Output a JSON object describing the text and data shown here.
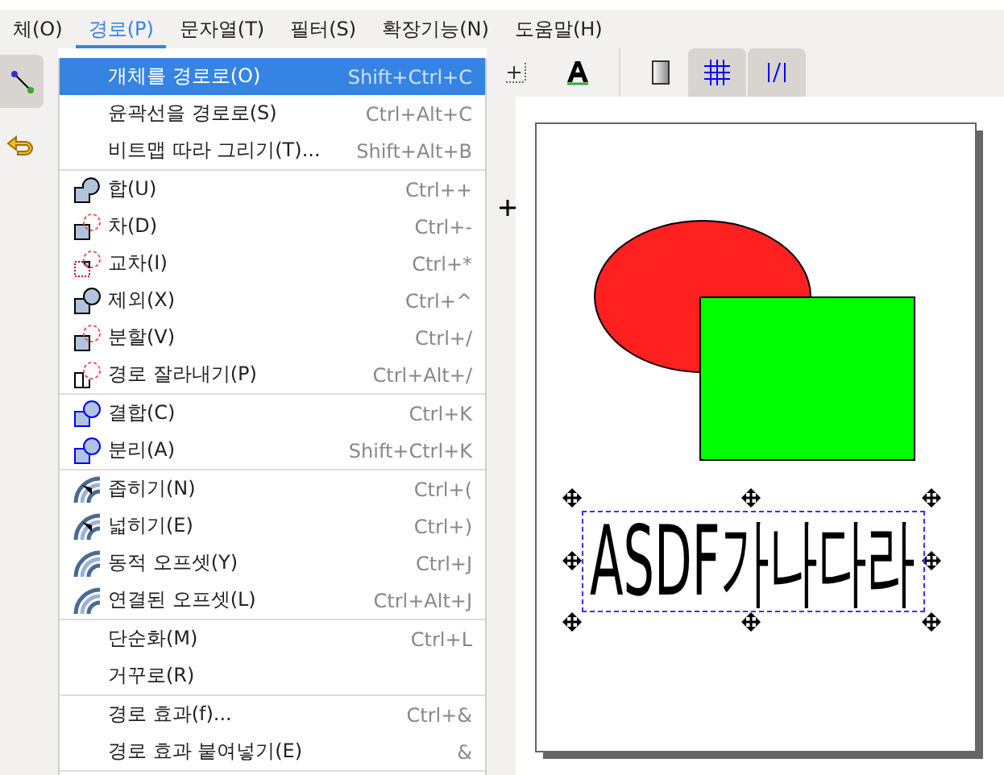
{
  "menubar": [
    {
      "label": "체(O)",
      "selected": false
    },
    {
      "label": "경로(P)",
      "selected": true
    },
    {
      "label": "문자열(T)",
      "selected": false
    },
    {
      "label": "필터(S)",
      "selected": false
    },
    {
      "label": "확장기능(N)",
      "selected": false
    },
    {
      "label": "도움말(H)",
      "selected": false
    }
  ],
  "menu": {
    "sections": [
      [
        {
          "kind": "plain",
          "label": "개체를 경로로(O)",
          "shortcut": "Shift+Ctrl+C",
          "selected": true
        },
        {
          "kind": "plain",
          "label": "윤곽선을 경로로(S)",
          "shortcut": "Ctrl+Alt+C",
          "selected": false
        },
        {
          "kind": "plain",
          "label": "비트맵 따라 그리기(T)...",
          "shortcut": "Shift+Alt+B",
          "selected": false
        }
      ],
      [
        {
          "kind": "boolean",
          "label": "합(U)",
          "shortcut": "Ctrl++",
          "selected": false
        },
        {
          "kind": "boolean",
          "label": "차(D)",
          "shortcut": "Ctrl+-",
          "selected": false
        },
        {
          "kind": "boolean",
          "label": "교차(I)",
          "shortcut": "Ctrl+*",
          "selected": false
        },
        {
          "kind": "boolean",
          "label": "제외(X)",
          "shortcut": "Ctrl+^",
          "selected": false
        },
        {
          "kind": "boolean",
          "label": "분할(V)",
          "shortcut": "Ctrl+/",
          "selected": false
        },
        {
          "kind": "boolean",
          "label": "경로 잘라내기(P)",
          "shortcut": "Ctrl+Alt+/",
          "selected": false
        }
      ],
      [
        {
          "kind": "combine",
          "label": "결합(C)",
          "shortcut": "Ctrl+K",
          "selected": false
        },
        {
          "kind": "combine",
          "label": "분리(A)",
          "shortcut": "Shift+Ctrl+K",
          "selected": false
        }
      ],
      [
        {
          "kind": "offset",
          "label": "좁히기(N)",
          "shortcut": "Ctrl+(",
          "selected": false
        },
        {
          "kind": "offset",
          "label": "넓히기(E)",
          "shortcut": "Ctrl+)",
          "selected": false
        },
        {
          "kind": "offset",
          "label": "동적 오프셋(Y)",
          "shortcut": "Ctrl+J",
          "selected": false
        },
        {
          "kind": "offset",
          "label": "연결된 오프셋(L)",
          "shortcut": "Ctrl+Alt+J",
          "selected": false
        }
      ],
      [
        {
          "kind": "plain",
          "label": "단순화(M)",
          "shortcut": "Ctrl+L",
          "selected": false
        },
        {
          "kind": "plain",
          "label": "거꾸로(R)",
          "selected": false
        }
      ],
      [
        {
          "kind": "plain",
          "label": "경로 효과(f)...",
          "shortcut": "Ctrl+&",
          "selected": false
        },
        {
          "kind": "plain",
          "label": "경로 효과 붙여넣기(E)",
          "shortcut": "&",
          "selected": false
        }
      ]
    ]
  },
  "canvas": {
    "text": "ASDF가나다라"
  }
}
